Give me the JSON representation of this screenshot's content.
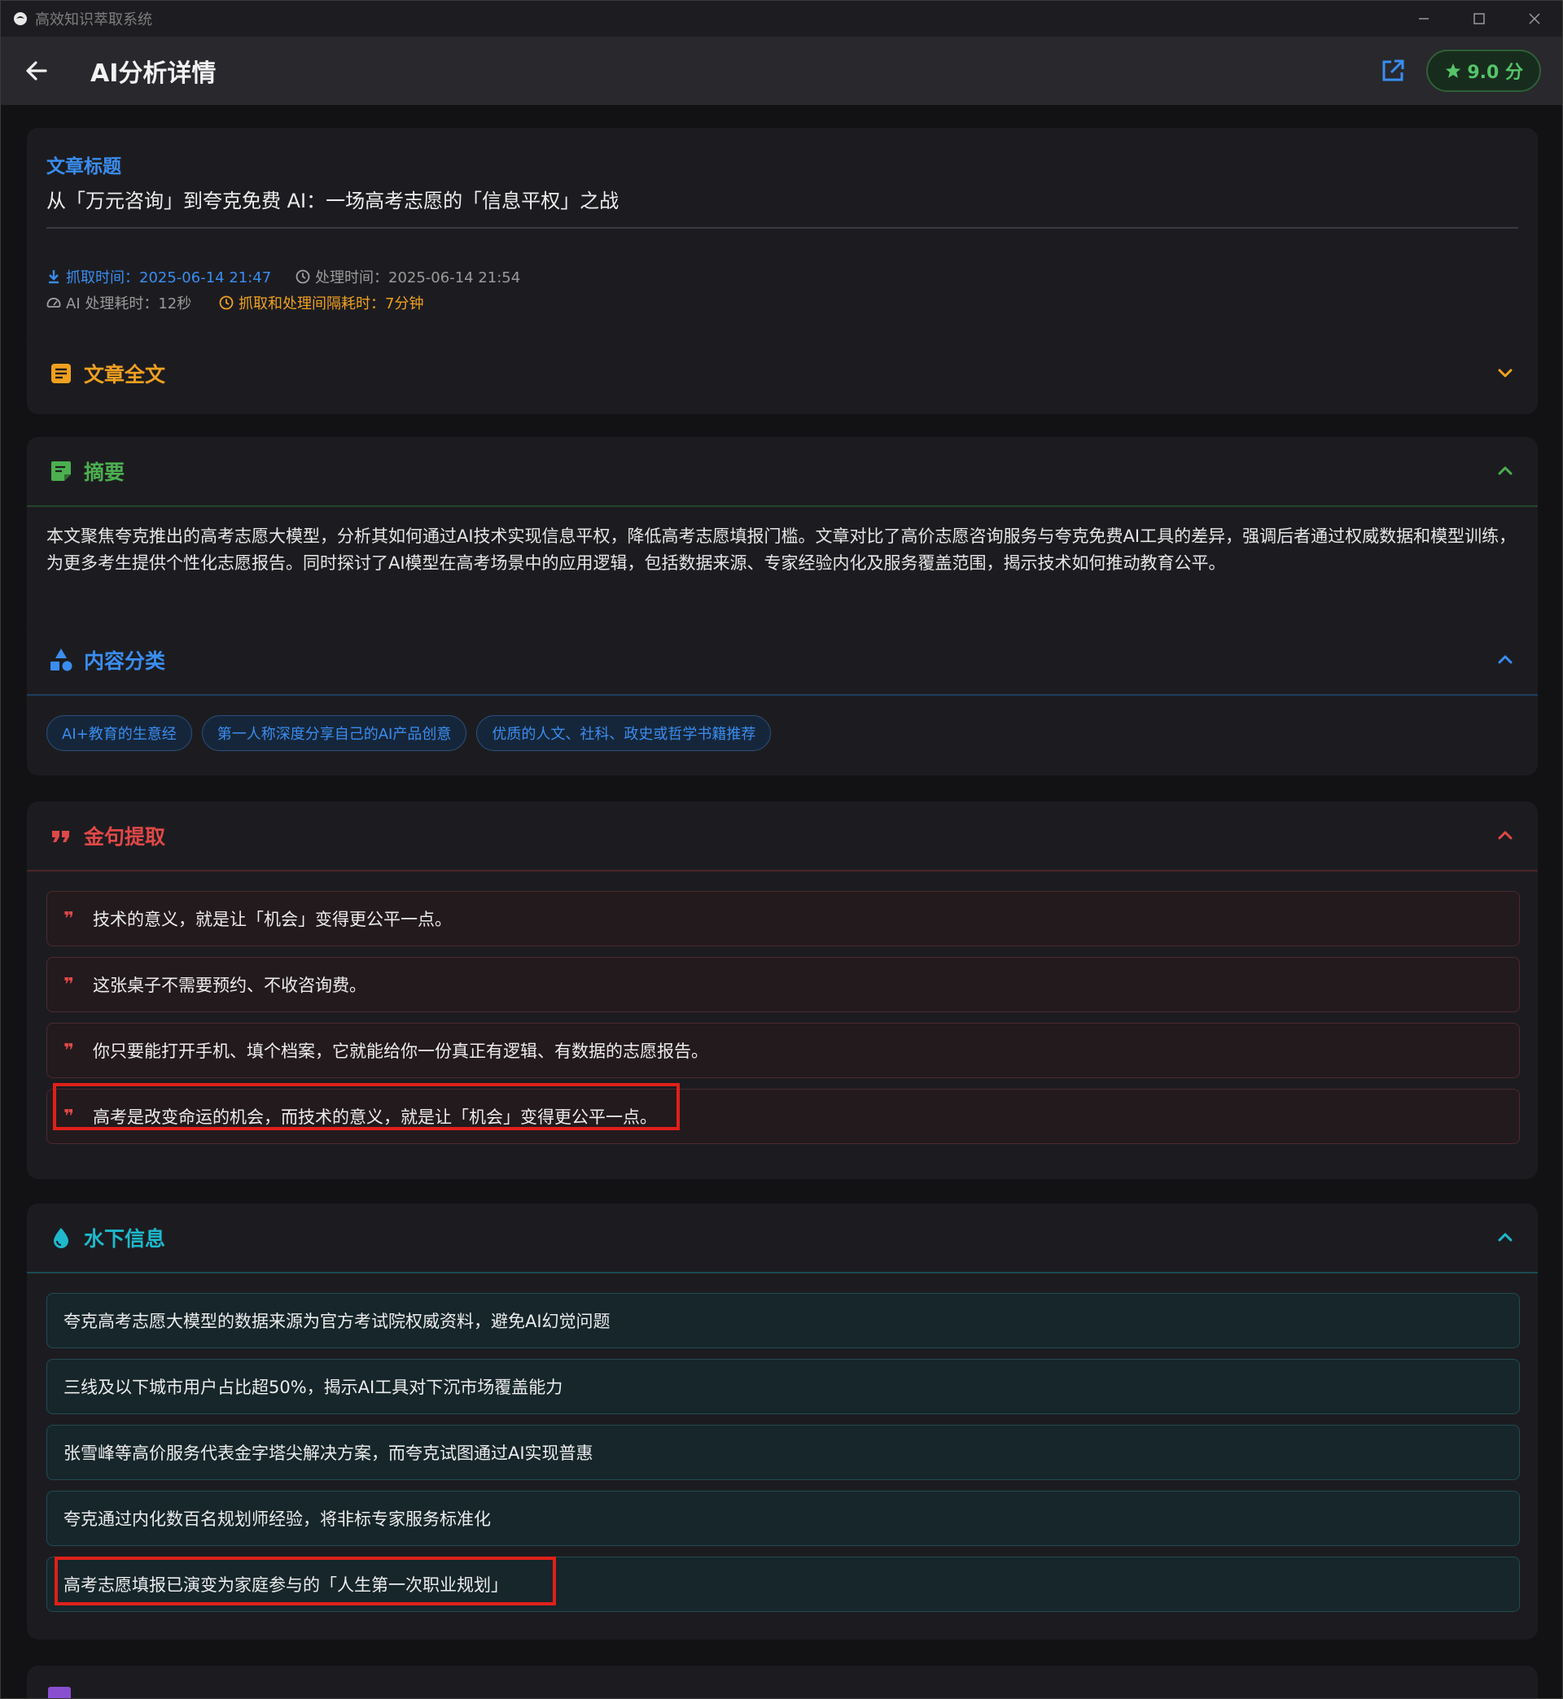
{
  "window": {
    "app_title": "高效知识萃取系统"
  },
  "header": {
    "title": "AI分析详情",
    "score": "9.0 分"
  },
  "article": {
    "label": "文章标题",
    "title": "从「万元咨询」到夸克免费 AI：一场高考志愿的「信息平权」之战",
    "fetch_time": "抓取时间：2025-06-14 21:47",
    "process_time": "处理时间：2025-06-14 21:54",
    "ai_duration": "AI 处理耗时：12秒",
    "interval": "抓取和处理间隔耗时：7分钟"
  },
  "fulltext": {
    "title": "文章全文"
  },
  "summary": {
    "title": "摘要",
    "text": "本文聚焦夸克推出的高考志愿大模型，分析其如何通过AI技术实现信息平权，降低高考志愿填报门槛。文章对比了高价志愿咨询服务与夸克免费AI工具的差异，强调后者通过权威数据和模型训练，为更多考生提供个性化志愿报告。同时探讨了AI模型在高考场景中的应用逻辑，包括数据来源、专家经验内化及服务覆盖范围，揭示技术如何推动教育公平。"
  },
  "categories": {
    "title": "内容分类",
    "tags": [
      "AI+教育的生意经",
      "第一人称深度分享自己的AI产品创意",
      "优质的人文、社科、政史或哲学书籍推荐"
    ]
  },
  "quotes": {
    "title": "金句提取",
    "items": [
      "技术的意义，就是让「机会」变得更公平一点。",
      "这张桌子不需要预约、不收咨询费。",
      "你只要能打开手机、填个档案，它就能给你一份真正有逻辑、有数据的志愿报告。",
      "高考是改变命运的机会，而技术的意义，就是让「机会」变得更公平一点。"
    ]
  },
  "underwater": {
    "title": "水下信息",
    "items": [
      "夸克高考志愿大模型的数据来源为官方考试院权威资料，避免AI幻觉问题",
      "三线及以下城市用户占比超50%，揭示AI工具对下沉市场覆盖能力",
      "张雪峰等高价服务代表金字塔尖解决方案，而夸克试图通过AI实现普惠",
      "夸克通过内化数百名规划师经验，将非标专家服务标准化",
      "高考志愿填报已演变为家庭参与的「人生第一次职业规划」"
    ]
  },
  "colors": {
    "blue": "#3a8df0",
    "orange": "#f0a020",
    "green": "#4caf50",
    "red": "#e04848",
    "cyan": "#1fb8cc",
    "purple": "#8a4fd0"
  },
  "icons": {
    "app": "app-logo-icon",
    "back": "arrow-left-icon",
    "external": "external-link-icon",
    "star": "star-icon",
    "download": "download-icon",
    "clock": "clock-icon",
    "speed": "speedometer-icon",
    "article": "document-icon",
    "summary": "note-icon",
    "category": "shapes-icon",
    "quote": "quote-icon",
    "water": "water-drop-icon"
  }
}
